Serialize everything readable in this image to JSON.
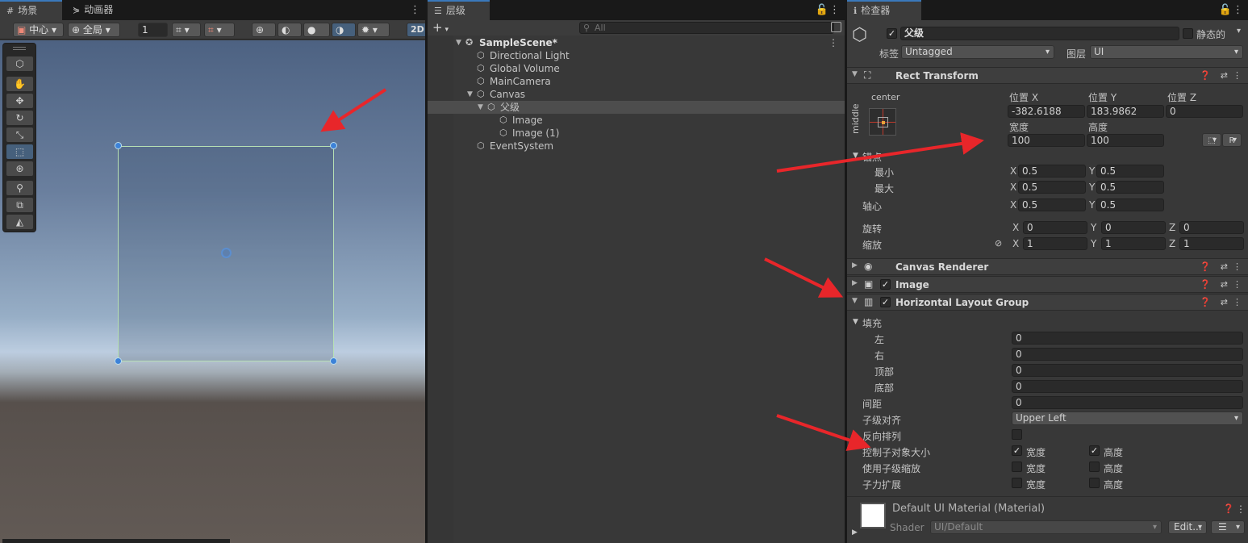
{
  "scene": {
    "tabs": [
      {
        "label": "场景",
        "icon": "grid-icon"
      },
      {
        "label": "动画器",
        "icon": "animator-icon"
      }
    ],
    "toolbar": {
      "pivot": "中心",
      "space": "全局",
      "grid_value": "1",
      "mode_2d": "2D"
    }
  },
  "hierarchy": {
    "tab": "层级",
    "search_placeholder": "All",
    "scene_name": "SampleScene*",
    "items": [
      {
        "label": "Directional Light",
        "depth": 1
      },
      {
        "label": "Global Volume",
        "depth": 1
      },
      {
        "label": "MainCamera",
        "depth": 1
      },
      {
        "label": "Canvas",
        "depth": 1,
        "expanded": true
      },
      {
        "label": "父级",
        "depth": 2,
        "expanded": true,
        "selected": true
      },
      {
        "label": "Image",
        "depth": 3
      },
      {
        "label": "Image (1)",
        "depth": 3
      },
      {
        "label": "EventSystem",
        "depth": 1
      }
    ]
  },
  "inspector": {
    "tab": "检查器",
    "object_name": "父级",
    "static_label": "静态的",
    "tag_label": "标签",
    "tag_value": "Untagged",
    "layer_label": "图层",
    "layer_value": "UI",
    "rect_transform": {
      "title": "Rect Transform",
      "anchor_h": "center",
      "anchor_v": "middle",
      "pos_x_label": "位置 X",
      "pos_y_label": "位置 Y",
      "pos_z_label": "位置 Z",
      "pos_x": "-382.6188",
      "pos_y": "183.9862",
      "pos_z": "0",
      "width_label": "宽度",
      "height_label": "高度",
      "width": "100",
      "height": "100",
      "raw_btn": "R",
      "anchors_label": "锚点",
      "min_label": "最小",
      "max_label": "最大",
      "min_x": "0.5",
      "min_y": "0.5",
      "max_x": "0.5",
      "max_y": "0.5",
      "pivot_label": "轴心",
      "pivot_x": "0.5",
      "pivot_y": "0.5",
      "rotation_label": "旋转",
      "rot_x": "0",
      "rot_y": "0",
      "rot_z": "0",
      "scale_label": "缩放",
      "scale_x": "1",
      "scale_y": "1",
      "scale_z": "1",
      "axis_x": "X",
      "axis_y": "Y",
      "axis_z": "Z"
    },
    "canvas_renderer": {
      "title": "Canvas Renderer"
    },
    "image": {
      "title": "Image"
    },
    "hlg": {
      "title": "Horizontal Layout Group",
      "padding_label": "填充",
      "left_label": "左",
      "left": "0",
      "right_label": "右",
      "right": "0",
      "top_label": "顶部",
      "top": "0",
      "bottom_label": "底部",
      "bottom": "0",
      "spacing_label": "间距",
      "spacing": "0",
      "child_align_label": "子级对齐",
      "child_align": "Upper Left",
      "reverse_label": "反向排列",
      "control_size_label": "控制子对象大小",
      "use_scale_label": "使用子级缩放",
      "force_expand_label": "子力扩展",
      "width_opt": "宽度",
      "height_opt": "高度",
      "control_size_width": true,
      "control_size_height": true,
      "use_scale_width": false,
      "use_scale_height": false,
      "force_expand_width": false,
      "force_expand_height": false,
      "reverse": false
    },
    "material": {
      "name": "Default UI Material (Material)",
      "shader_label": "Shader",
      "shader_value": "UI/Default",
      "edit_btn": "Edit..."
    }
  },
  "colors": {
    "accent": "#3a79bb",
    "arrow": "#e8262a",
    "selection_outline": "#b7e0b4"
  }
}
